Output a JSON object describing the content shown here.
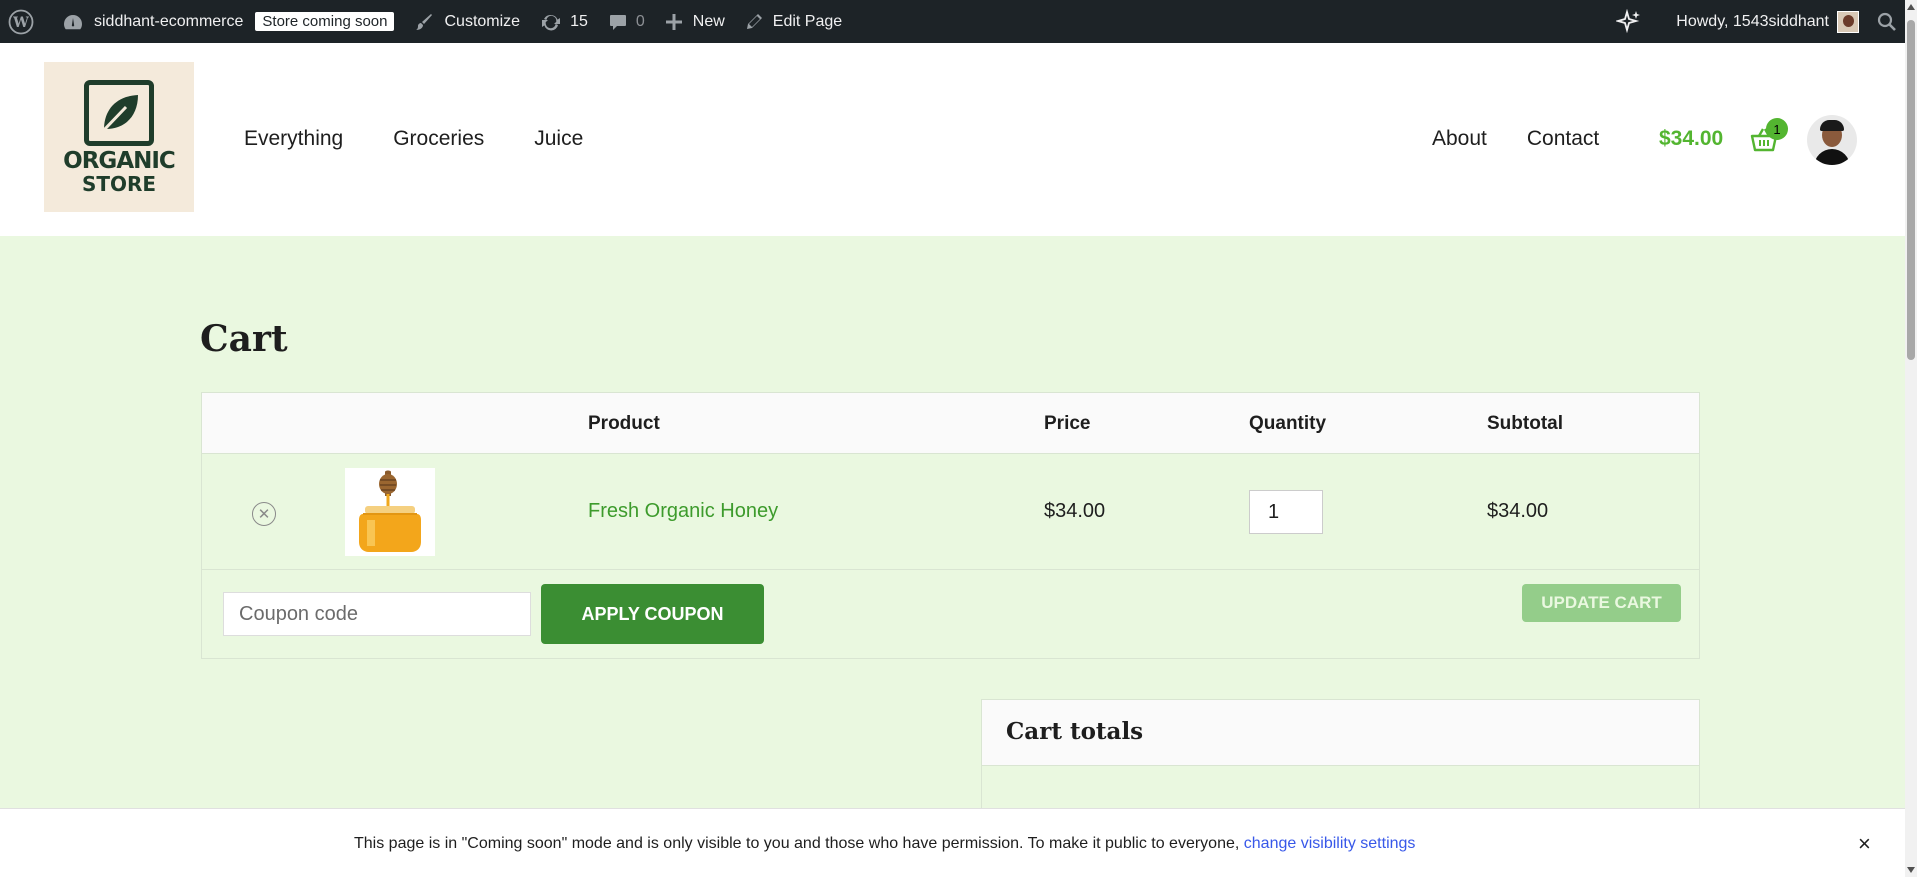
{
  "adminbar": {
    "site_name": "siddhant-ecommerce",
    "badge": "Store coming soon",
    "customize": "Customize",
    "updates_count": "15",
    "comments_count": "0",
    "new": "New",
    "edit_page": "Edit Page",
    "howdy": "Howdy, 1543siddhant"
  },
  "header": {
    "logo_line1": "ORGANIC",
    "logo_line2": "STORE",
    "nav_left": [
      "Everything",
      "Groceries",
      "Juice"
    ],
    "nav_right": [
      "About",
      "Contact"
    ],
    "cart_total": "$34.00",
    "cart_count": "1"
  },
  "page": {
    "title": "Cart"
  },
  "cart": {
    "headers": {
      "product": "Product",
      "price": "Price",
      "quantity": "Quantity",
      "subtotal": "Subtotal"
    },
    "items": [
      {
        "name": "Fresh Organic Honey",
        "price": "$34.00",
        "quantity": "1",
        "subtotal": "$34.00"
      }
    ],
    "coupon_placeholder": "Coupon code",
    "apply_coupon": "APPLY COUPON",
    "update_cart": "UPDATE CART"
  },
  "totals": {
    "title": "Cart totals"
  },
  "notice": {
    "text": "This page is in \"Coming soon\" mode and is only visible to you and those who have permission. To make it public to everyone,",
    "link": "change visibility settings",
    "close": "×"
  },
  "colors": {
    "accent_green": "#53b530",
    "button_green": "#3b8e33",
    "page_bg": "#eaf8e0",
    "admin_bar": "#1d2327"
  }
}
